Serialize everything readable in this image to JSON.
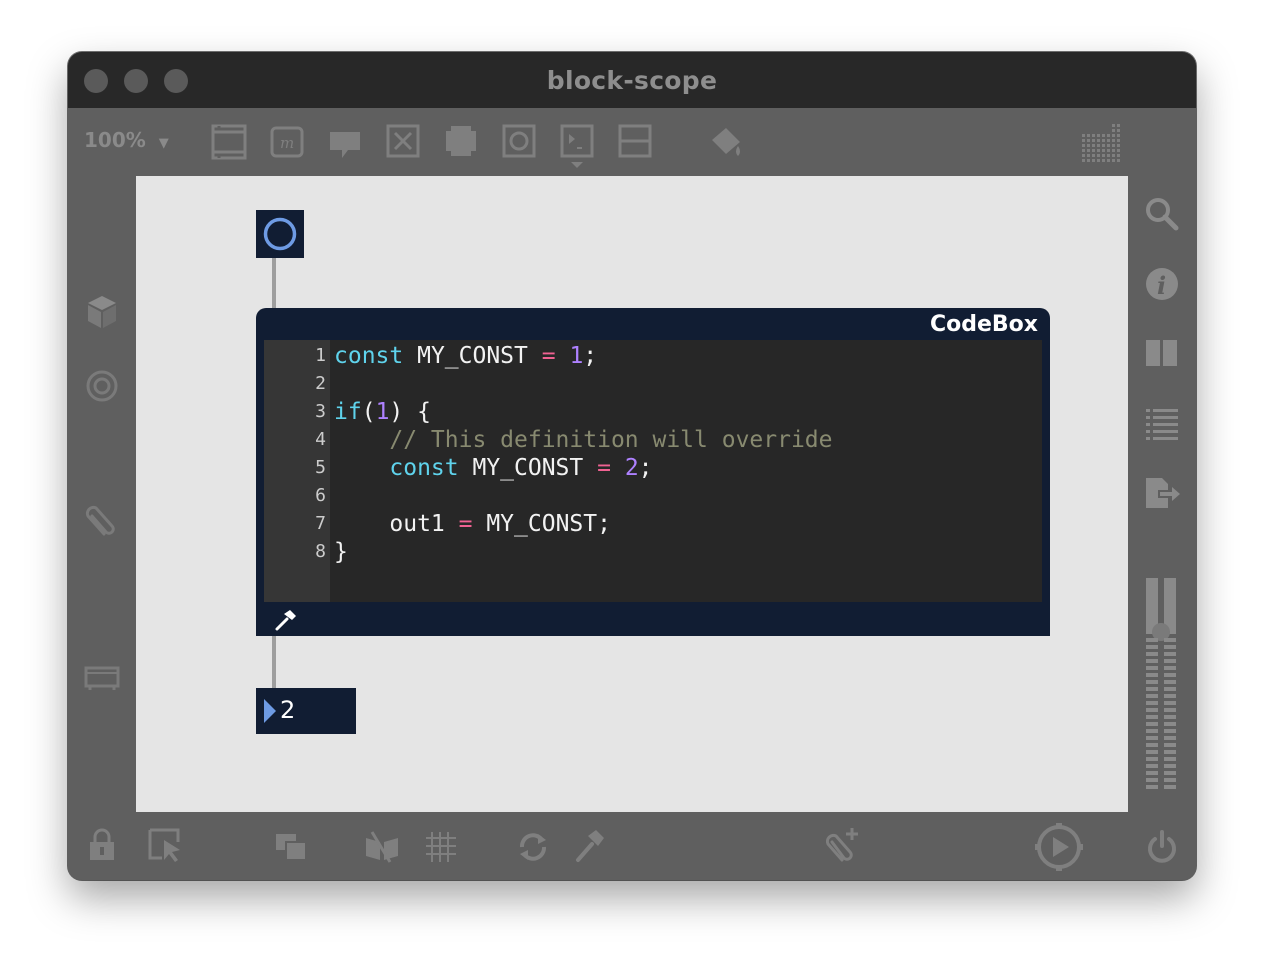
{
  "window": {
    "title": "block-scope"
  },
  "toolbar": {
    "zoom_label": "100%",
    "icons": [
      "comment-icon",
      "message-icon",
      "bubble-icon",
      "button-icon",
      "toggle-icon",
      "slider-icon",
      "number-icon",
      "line-icon",
      "paint-bucket-icon",
      "grid-icon"
    ]
  },
  "codebox": {
    "label": "CodeBox",
    "lines": [
      {
        "n": "1",
        "tokens": [
          [
            "kw",
            "const"
          ],
          [
            "",
            "MY_CONST "
          ],
          [
            "op",
            "="
          ],
          [
            "",
            ""
          ],
          [
            "num",
            "1"
          ],
          [
            "",
            ";"
          ]
        ]
      },
      {
        "n": "2",
        "tokens": []
      },
      {
        "n": "3",
        "tokens": [
          [
            "kw",
            "if"
          ],
          [
            "",
            "("
          ],
          [
            "num",
            "1"
          ],
          [
            "",
            ") {"
          ]
        ]
      },
      {
        "n": "4",
        "tokens": [
          [
            "cm",
            "    // This definition will override"
          ]
        ]
      },
      {
        "n": "5",
        "tokens": [
          [
            "kw",
            "    const"
          ],
          [
            "",
            "MY_CONST "
          ],
          [
            "op",
            "="
          ],
          [
            "",
            ""
          ],
          [
            "num",
            "2"
          ],
          [
            "",
            ";"
          ]
        ]
      },
      {
        "n": "6",
        "tokens": []
      },
      {
        "n": "7",
        "tokens": [
          [
            "",
            "    out1 "
          ],
          [
            "op",
            "="
          ],
          [
            "",
            "MY_CONST;"
          ]
        ]
      },
      {
        "n": "8",
        "tokens": [
          [
            "",
            "}"
          ]
        ]
      }
    ]
  },
  "message": {
    "value": "2"
  },
  "colors": {
    "object_bg": "#111d33",
    "keyword": "#5fd3ec",
    "operator": "#f06292",
    "number": "#ae81ff",
    "comment": "#888a70"
  }
}
